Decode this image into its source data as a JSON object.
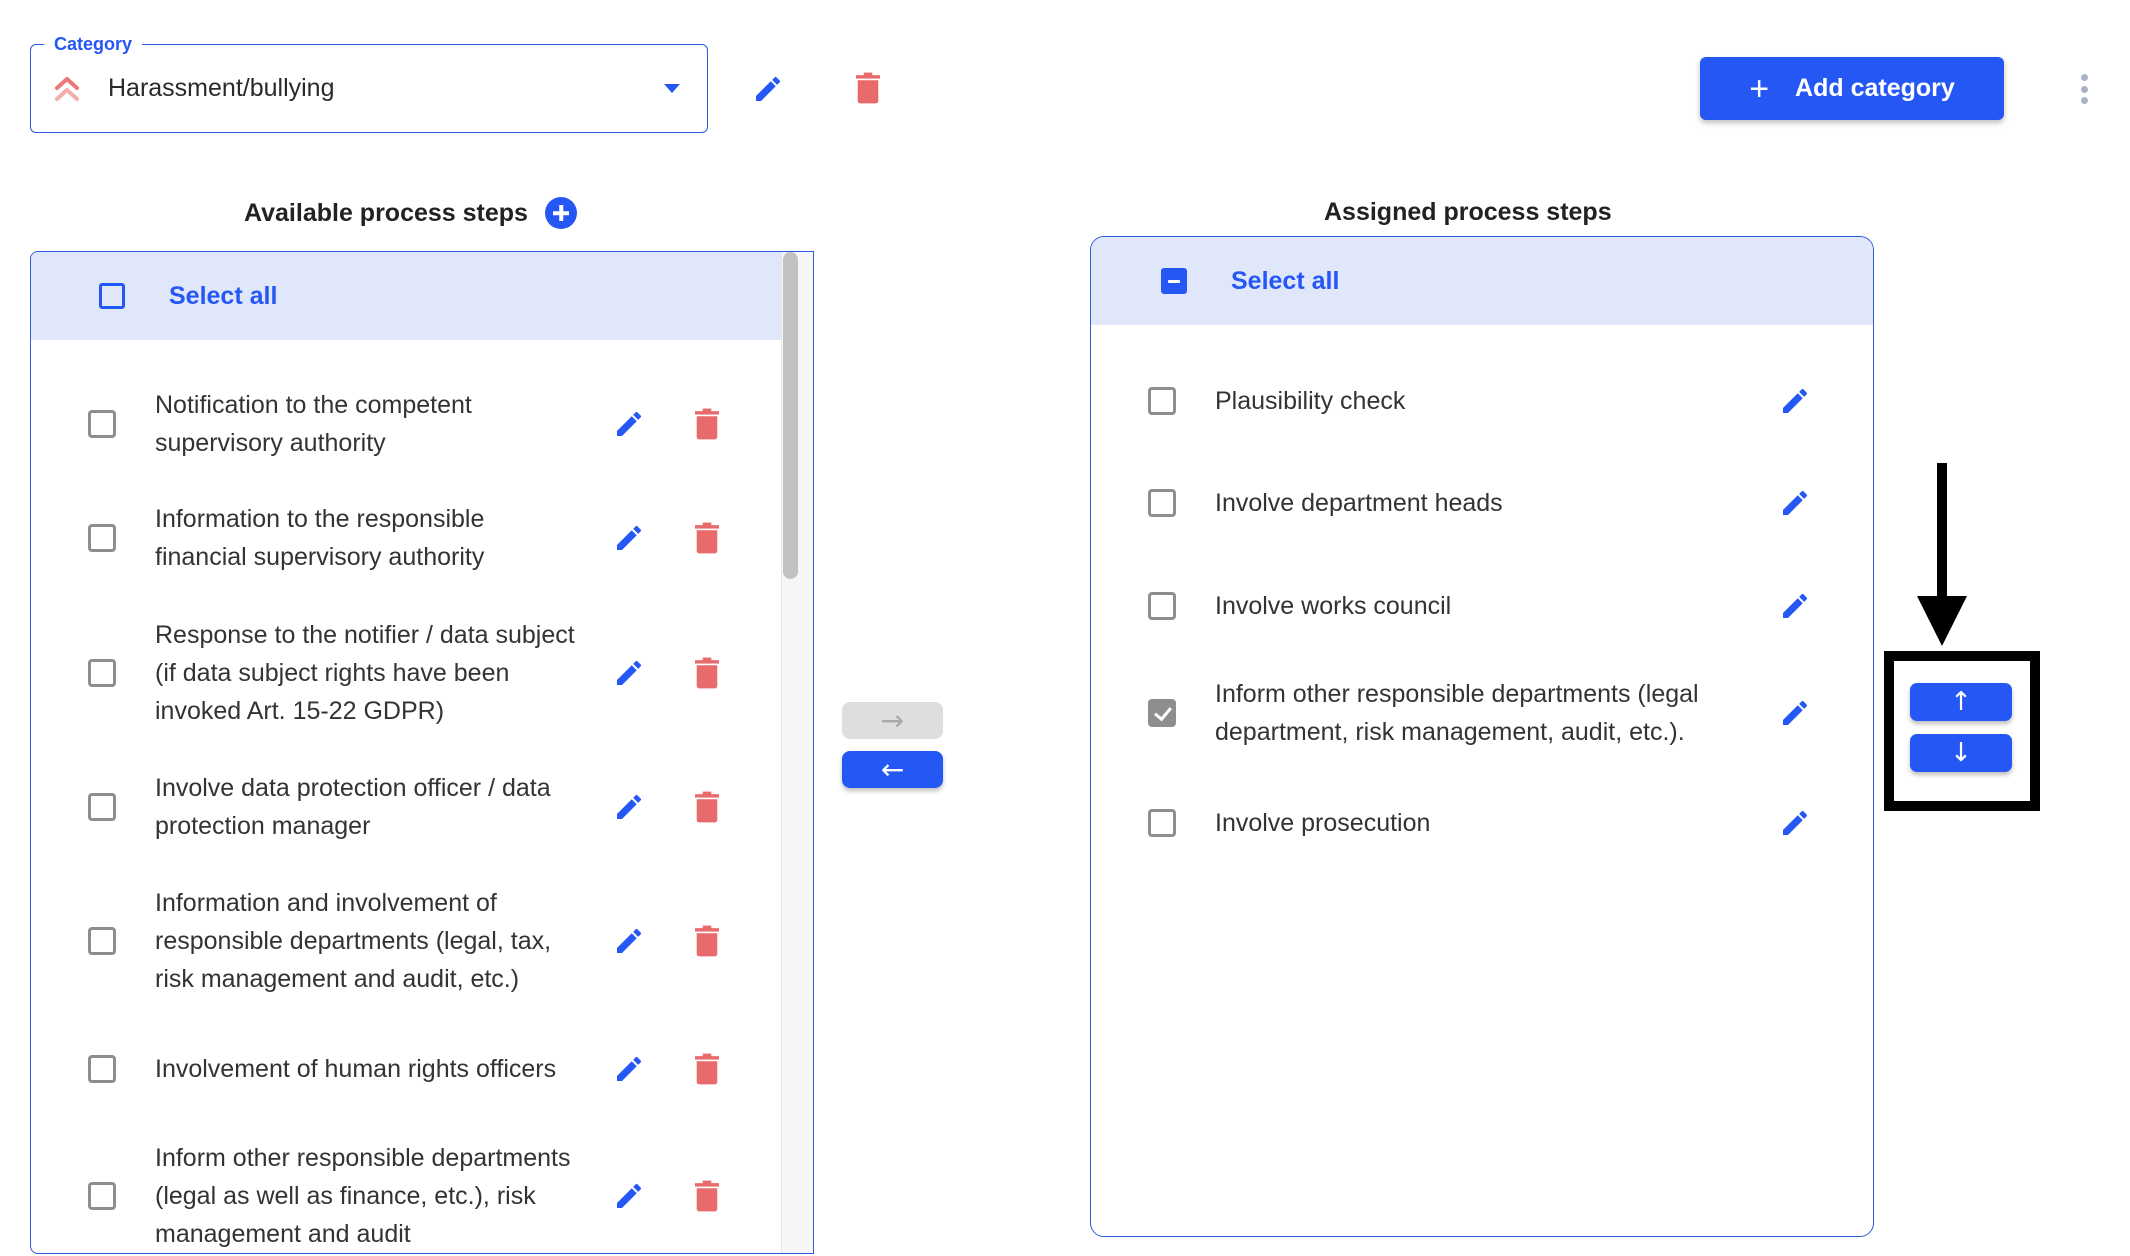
{
  "category": {
    "label": "Category",
    "value": "Harassment/bullying",
    "priority_icon": "double-chevron-up-icon",
    "edit_icon": "pencil-icon",
    "delete_icon": "trash-icon"
  },
  "toolbar": {
    "add_category_plus": "+",
    "add_category_label": "Add category",
    "more_icon": "kebab-menu-icon"
  },
  "available": {
    "title": "Available process steps",
    "add_icon": "plus-circle-icon",
    "select_all_label": "Select all",
    "select_all_state": "unchecked",
    "items": [
      {
        "lines": [
          "Notification to the competent",
          "supervisory authority"
        ],
        "checked": false
      },
      {
        "lines": [
          "Information to the responsible",
          "financial supervisory authority"
        ],
        "checked": false
      },
      {
        "lines": [
          "Response to the notifier / data subject",
          "(if data subject rights have been",
          "invoked Art. 15-22 GDPR)"
        ],
        "checked": false
      },
      {
        "lines": [
          "Involve data protection officer / data",
          "protection manager"
        ],
        "checked": false
      },
      {
        "lines": [
          "Information and involvement of",
          "responsible departments (legal, tax,",
          "risk management and audit, etc.)"
        ],
        "checked": false
      },
      {
        "lines": [
          "Involvement of human rights officers"
        ],
        "checked": false
      },
      {
        "lines": [
          "Inform other responsible departments",
          "(legal as well as finance, etc.), risk",
          "management and audit"
        ],
        "checked": false
      }
    ]
  },
  "transfer": {
    "move_right": "→",
    "move_left": "←"
  },
  "assigned": {
    "title": "Assigned process steps",
    "select_all_label": "Select all",
    "select_all_state": "indeterminate",
    "items": [
      {
        "lines": [
          "Plausibility check"
        ],
        "checked": false
      },
      {
        "lines": [
          "Involve department heads"
        ],
        "checked": false
      },
      {
        "lines": [
          "Involve works council"
        ],
        "checked": false
      },
      {
        "lines": [
          "Inform other responsible departments (legal",
          "department, risk management, audit, etc.)."
        ],
        "checked": true
      },
      {
        "lines": [
          "Involve prosecution"
        ],
        "checked": false
      }
    ]
  },
  "reorder": {
    "move_up": "↑",
    "move_down": "↓"
  },
  "colors": {
    "accent": "#2557f5",
    "danger": "#e96a6a",
    "header_band": "#e0e7fb",
    "checkbox_gray": "#8e8e8e"
  }
}
